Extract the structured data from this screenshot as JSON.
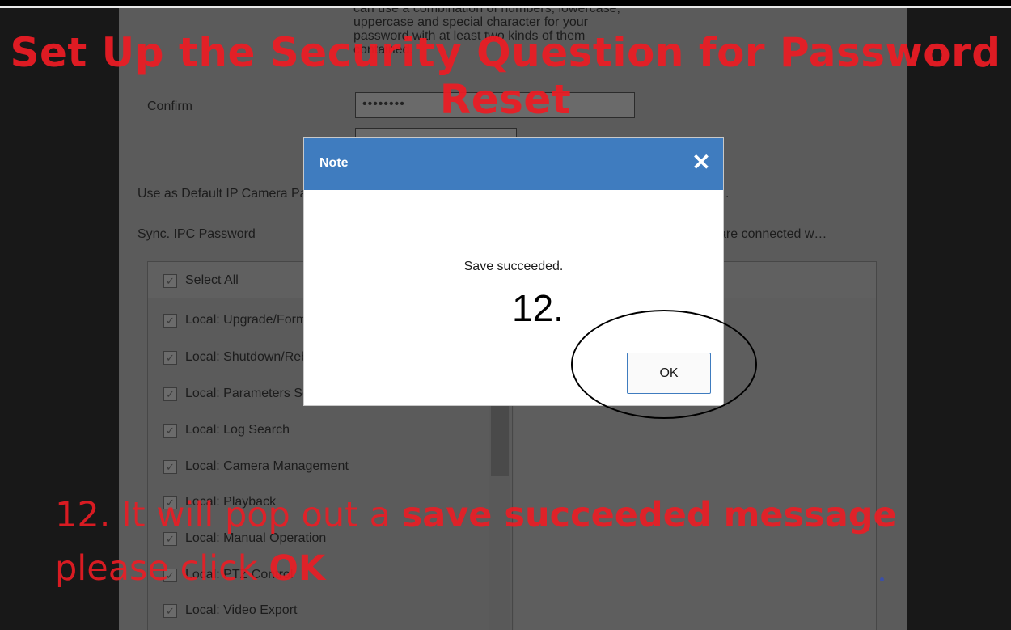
{
  "background_form": {
    "hint_text": "can use a combination of numbers, lowercase, uppercase and special character for your password with at least two kinds of them contained.",
    "confirm_label": "Confirm",
    "confirm_value": "••••••••",
    "default_ip_camera_label": "Use as Default IP Camera Password",
    "default_ip_camera_tail": ".",
    "sync_ipc_label": "Sync. IPC Password",
    "sync_ipc_tail": "are connected w…",
    "permissions": {
      "select_all": "Select All",
      "items": [
        "Local: Upgrade/Format",
        "Local: Shutdown/Reboot",
        "Local: Parameters Settings",
        "Local: Log Search",
        "Local: Camera Management",
        "Local: Playback",
        "Local: Manual Operation",
        "Local: PTZ Control",
        "Local: Video Export"
      ],
      "checkmark": "✓"
    }
  },
  "dialog": {
    "title": "Note",
    "close_glyph": "✕",
    "message": "Save succeeded.",
    "ok_label": "OK"
  },
  "annotation": {
    "step_marker": "12.",
    "title": "Set Up the Security Question for Password Reset",
    "caption_line1_prefix": "12. It will pop out a ",
    "caption_line1_bold": "save succeeded message",
    "caption_line2_prefix": "please click ",
    "caption_line2_bold": "OK"
  },
  "colors": {
    "dialog_header": "#3f7cbf",
    "annotation_red": "#ed1c24",
    "dim_overlay": "#5b5b5b"
  },
  "icons": [
    "close-icon",
    "checkbox-checked-icon"
  ]
}
